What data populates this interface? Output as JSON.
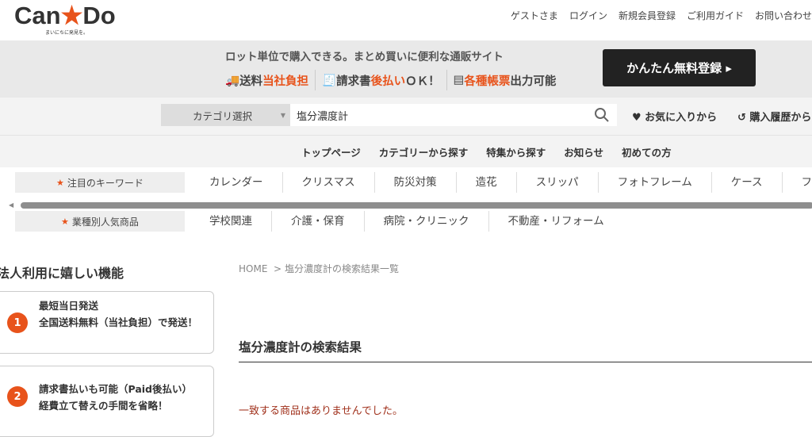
{
  "header": {
    "logo_left": "Can",
    "logo_right": "Do",
    "tagline": "まいにちに発見を。",
    "links": [
      "ゲストさま",
      "ログイン",
      "新規会員登録",
      "ご利用ガイド",
      "お問い合わせ"
    ]
  },
  "banner": {
    "headline": "ロット単位で購入できる。まとめ買いに便利な通販サイト",
    "f1a": "送料",
    "f1b": "当社負担",
    "f2a": "請求書",
    "f2b": "後払い",
    "f2c": "ＯＫ！",
    "f3a": "各種帳票",
    "f3b": "出力可能",
    "register_button": "かんたん無料登録 ▸"
  },
  "search": {
    "category": "カテゴリ選択",
    "query": "塩分濃度計",
    "favorites": "♥ お気に入りから",
    "history": "↺ 購入履歴から"
  },
  "nav": [
    "トップページ",
    "カテゴリーから探す",
    "特集から探す",
    "お知らせ",
    "初めての方"
  ],
  "keywords": {
    "label": "注目のキーワード",
    "items": [
      "カレンダー",
      "クリスマス",
      "防災対策",
      "造花",
      "スリッパ",
      "フォトフレーム",
      "ケース",
      "ファ"
    ]
  },
  "industry": {
    "label": "業種別人気商品",
    "items": [
      "学校関連",
      "介護・保育",
      "病院・クリニック",
      "不動産・リフォーム"
    ]
  },
  "sidebar": {
    "title": "法人利用に嬉しい機能",
    "cards": [
      {
        "num": "1",
        "line1": "最短当日発送",
        "line2": "全国送料無料（当社負担）で発送！"
      },
      {
        "num": "2",
        "line1": "請求書払いも可能（Paid後払い）",
        "line2": "経費立て替えの手間を省略！"
      }
    ]
  },
  "main": {
    "breadcrumb_home": "HOME",
    "breadcrumb_sep": ">",
    "breadcrumb_current": "塩分濃度計の検索結果一覧",
    "result_title": "塩分濃度計の検索結果",
    "no_results": "一致する商品はありませんでした。"
  },
  "colors": {
    "accent": "#e8531b",
    "dark": "#222222"
  }
}
